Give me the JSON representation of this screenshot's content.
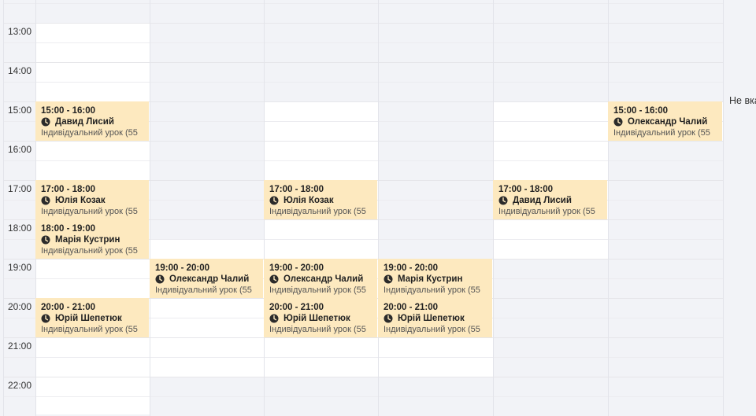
{
  "times": [
    "13:00",
    "14:00",
    "15:00",
    "16:00",
    "17:00",
    "18:00",
    "19:00",
    "20:00",
    "21:00",
    "22:00"
  ],
  "side_note": "Не вка",
  "events": [
    {
      "time": "15:00 - 16:00",
      "name": "Давид Лисий",
      "type": "Індивідуальний урок (55"
    },
    {
      "time": "17:00 - 18:00",
      "name": "Юлія Козак",
      "type": "Індивідуальний урок (55"
    },
    {
      "time": "18:00 - 19:00",
      "name": "Марія Кустрин",
      "type": "Індивідуальний урок (55"
    },
    {
      "time": "20:00 - 21:00",
      "name": "Юрій Шепетюк",
      "type": "Індивідуальний урок (55"
    },
    {
      "time": "19:00 - 20:00",
      "name": "Олександр Чалий",
      "type": "Індивідуальний урок (55"
    },
    {
      "time": "17:00 - 18:00",
      "name": "Юлія Козак",
      "type": "Індивідуальний урок (55"
    },
    {
      "time": "19:00 - 20:00",
      "name": "Олександр Чалий",
      "type": "Індивідуальний урок (55"
    },
    {
      "time": "20:00 - 21:00",
      "name": "Юрій Шепетюк",
      "type": "Індивідуальний урок (55"
    },
    {
      "time": "19:00 - 20:00",
      "name": "Марія Кустрин",
      "type": "Індивідуальний урок (55"
    },
    {
      "time": "20:00 - 21:00",
      "name": "Юрій Шепетюк",
      "type": "Індивідуальний урок (55"
    },
    {
      "time": "17:00 - 18:00",
      "name": "Давид Лисий",
      "type": "Індивідуальний урок (55"
    },
    {
      "time": "15:00 - 16:00",
      "name": "Олександр Чалий",
      "type": "Індивідуальний урок (55"
    }
  ],
  "icons": {
    "event_clock": "clock-icon"
  },
  "colors": {
    "event_bg": "#fde9bf",
    "available_bg": "#ffffff",
    "unavailable_bg": "#f2f3f7"
  }
}
